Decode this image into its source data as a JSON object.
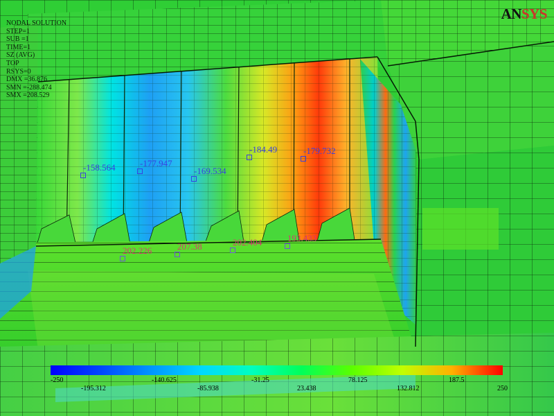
{
  "window": {
    "logo_prefix": "AN",
    "logo_suffix": "SYS"
  },
  "header": {
    "lines": [
      "NODAL SOLUTION",
      "STEP=1",
      "SUB =1",
      "TIME=1",
      "SZ       (AVG)",
      "TOP",
      "RSYS=0",
      "DMX =36.876",
      "SMN =-288.474",
      "SMX =208.529"
    ]
  },
  "annotations": [
    {
      "value": "-158.564",
      "kind": "negative"
    },
    {
      "value": "-177.947",
      "kind": "negative"
    },
    {
      "value": "-169.534",
      "kind": "negative"
    },
    {
      "value": "-184.49",
      "kind": "negative"
    },
    {
      "value": "-179.732",
      "kind": "negative"
    },
    {
      "value": "202.226",
      "kind": "positive"
    },
    {
      "value": "207.38",
      "kind": "positive"
    },
    {
      "value": "202.404",
      "kind": "positive"
    },
    {
      "value": "193.433",
      "kind": "positive"
    }
  ],
  "legend": {
    "labels": [
      "-250",
      "-195.312",
      "-140.625",
      "-85.938",
      "-31.25",
      "23.438",
      "78.125",
      "132.812",
      "187.5",
      "250"
    ]
  },
  "colors": {
    "background": "#ffffff",
    "mesh_green": "#2fd12f",
    "mesh_line": "#0c2a0c",
    "stress_high": "#ff2a00",
    "stress_low": "#1e90ff"
  }
}
